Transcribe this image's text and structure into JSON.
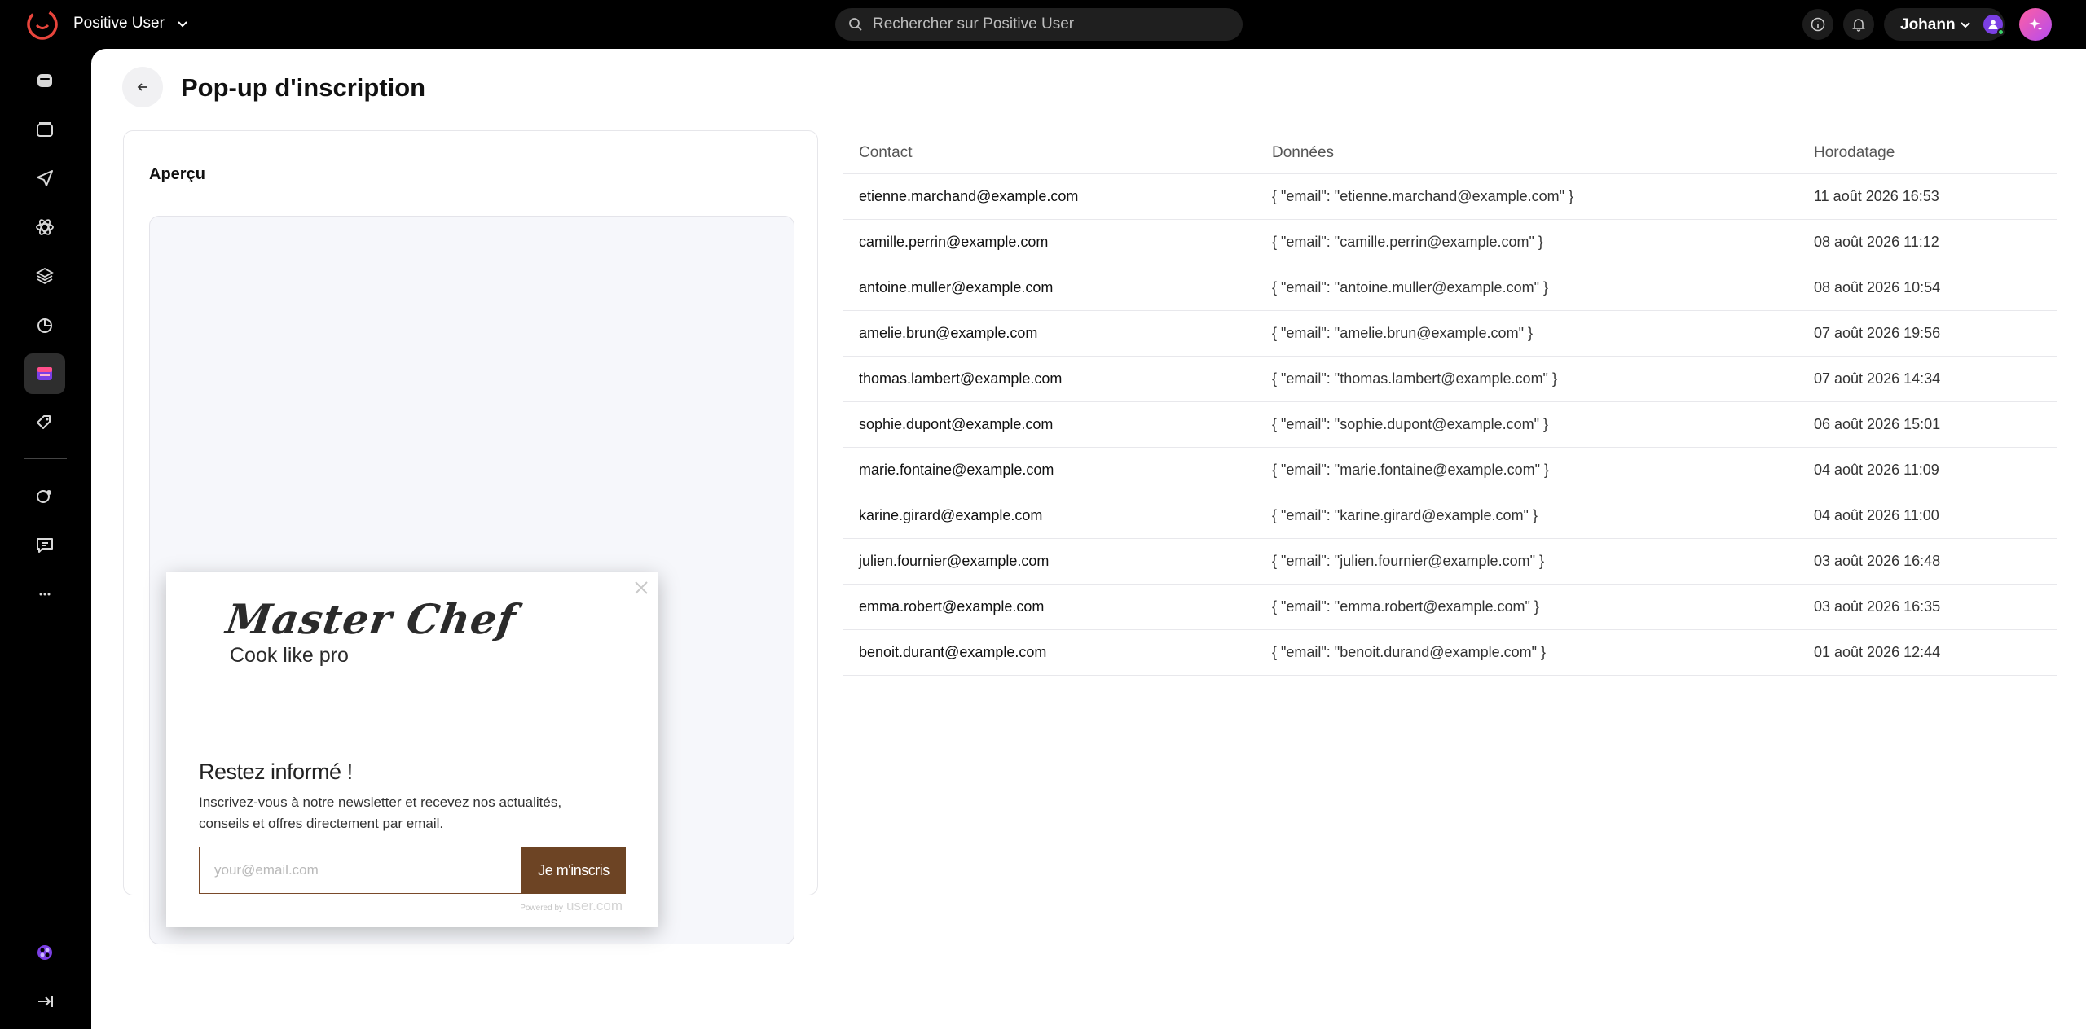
{
  "app": {
    "name": "Positive User"
  },
  "search": {
    "placeholder": "Rechercher sur Positive User"
  },
  "user": {
    "name": "Johann"
  },
  "page": {
    "title": "Pop-up d'inscription"
  },
  "preview": {
    "title": "Aperçu",
    "popup": {
      "brand": "Master Chef",
      "tagline": "Cook like pro",
      "heading": "Restez informé !",
      "text": "Inscrivez-vous à notre newsletter et recevez nos actualités, conseils et offres directement par email.",
      "email_placeholder": "your@email.com",
      "submit_label": "Je m'inscris",
      "powered_by": "Powered by",
      "powered_brand": "user.com"
    }
  },
  "table": {
    "headers": {
      "contact": "Contact",
      "data": "Données",
      "timestamp": "Horodatage"
    },
    "rows": [
      {
        "contact": "etienne.marchand@example.com",
        "data": "{ \"email\": \"etienne.marchand@example.com\" }",
        "timestamp": "11 août 2026 16:53"
      },
      {
        "contact": "camille.perrin@example.com",
        "data": "{ \"email\": \"camille.perrin@example.com\" }",
        "timestamp": "08 août 2026 11:12"
      },
      {
        "contact": "antoine.muller@example.com",
        "data": "{ \"email\": \"antoine.muller@example.com\" }",
        "timestamp": "08 août 2026 10:54"
      },
      {
        "contact": "amelie.brun@example.com",
        "data": "{ \"email\": \"amelie.brun@example.com\" }",
        "timestamp": "07 août 2026 19:56"
      },
      {
        "contact": "thomas.lambert@example.com",
        "data": "{ \"email\": \"thomas.lambert@example.com\" }",
        "timestamp": "07 août 2026 14:34"
      },
      {
        "contact": "sophie.dupont@example.com",
        "data": "{ \"email\": \"sophie.dupont@example.com\" }",
        "timestamp": "06 août 2026 15:01"
      },
      {
        "contact": "marie.fontaine@example.com",
        "data": "{ \"email\": \"marie.fontaine@example.com\" }",
        "timestamp": "04 août 2026 11:09"
      },
      {
        "contact": "karine.girard@example.com",
        "data": "{ \"email\": \"karine.girard@example.com\" }",
        "timestamp": "04 août 2026 11:00"
      },
      {
        "contact": "julien.fournier@example.com",
        "data": "{ \"email\": \"julien.fournier@example.com\" }",
        "timestamp": "03 août 2026 16:48"
      },
      {
        "contact": "emma.robert@example.com",
        "data": "{ \"email\": \"emma.robert@example.com\" }",
        "timestamp": "03 août 2026 16:35"
      },
      {
        "contact": "benoit.durant@example.com",
        "data": "{ \"email\": \"benoit.durand@example.com\" }",
        "timestamp": "01 août 2026 12:44"
      }
    ]
  },
  "sidebar": {
    "icons": [
      "inbox-icon",
      "folder-icon",
      "send-icon",
      "atom-icon",
      "layers-icon",
      "chart-pie-icon",
      "popup-icon",
      "tags-icon",
      "users-dot-icon",
      "chat-settings-icon",
      "more-icon",
      "integration-icon",
      "logout-icon"
    ],
    "active": "popup-icon"
  },
  "colors": {
    "accent": "#6d4424",
    "brand": "#e8453c",
    "ai_gradient_start": "#ff5fa2",
    "ai_gradient_end": "#b44cf0",
    "avatar": "#7b3fe4"
  }
}
